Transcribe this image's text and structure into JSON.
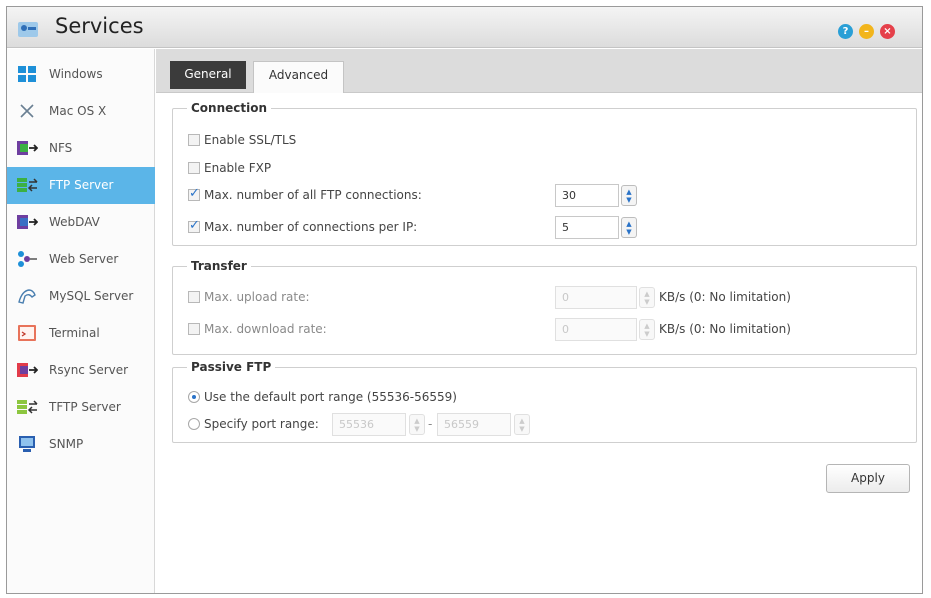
{
  "window": {
    "title": "Services",
    "controls": {
      "help": "?",
      "minimize": "–",
      "close": "×"
    }
  },
  "sidebar": {
    "items": [
      {
        "label": "Windows",
        "icon": "windows-icon"
      },
      {
        "label": "Mac OS X",
        "icon": "mac-os-x-icon"
      },
      {
        "label": "NFS",
        "icon": "nfs-icon"
      },
      {
        "label": "FTP Server",
        "icon": "ftp-server-icon",
        "selected": true
      },
      {
        "label": "WebDAV",
        "icon": "webdav-icon"
      },
      {
        "label": "Web Server",
        "icon": "web-server-icon"
      },
      {
        "label": "MySQL Server",
        "icon": "mysql-server-icon"
      },
      {
        "label": "Terminal",
        "icon": "terminal-icon"
      },
      {
        "label": "Rsync Server",
        "icon": "rsync-server-icon"
      },
      {
        "label": "TFTP Server",
        "icon": "tftp-server-icon"
      },
      {
        "label": "SNMP",
        "icon": "snmp-icon"
      }
    ]
  },
  "tabs": {
    "general": "General",
    "advanced": "Advanced",
    "active": "Advanced"
  },
  "connection": {
    "legend": "Connection",
    "enable_ssl_tls": {
      "label": "Enable SSL/TLS",
      "checked": false
    },
    "enable_fxp": {
      "label": "Enable FXP",
      "checked": false
    },
    "max_all": {
      "label": "Max. number of all FTP connections:",
      "checked": true,
      "value": "30"
    },
    "max_per_ip": {
      "label": "Max. number of connections per IP:",
      "checked": true,
      "value": "5"
    }
  },
  "transfer": {
    "legend": "Transfer",
    "max_upload": {
      "label": "Max. upload rate:",
      "checked": false,
      "value": "0",
      "unit": "KB/s (0: No limitation)"
    },
    "max_download": {
      "label": "Max. download rate:",
      "checked": false,
      "value": "0",
      "unit": "KB/s (0: No limitation)"
    }
  },
  "passive_ftp": {
    "legend": "Passive FTP",
    "default_range": {
      "label": "Use the default port range (55536-56559)",
      "selected": true
    },
    "specify_range": {
      "label": "Specify port range:",
      "selected": false,
      "from": "55536",
      "separator": "-",
      "to": "56559"
    }
  },
  "apply_button": "Apply",
  "colors": {
    "selected": "#5bb5e8",
    "active_tab": "#3b3b3b",
    "check": "#2a73c8"
  }
}
